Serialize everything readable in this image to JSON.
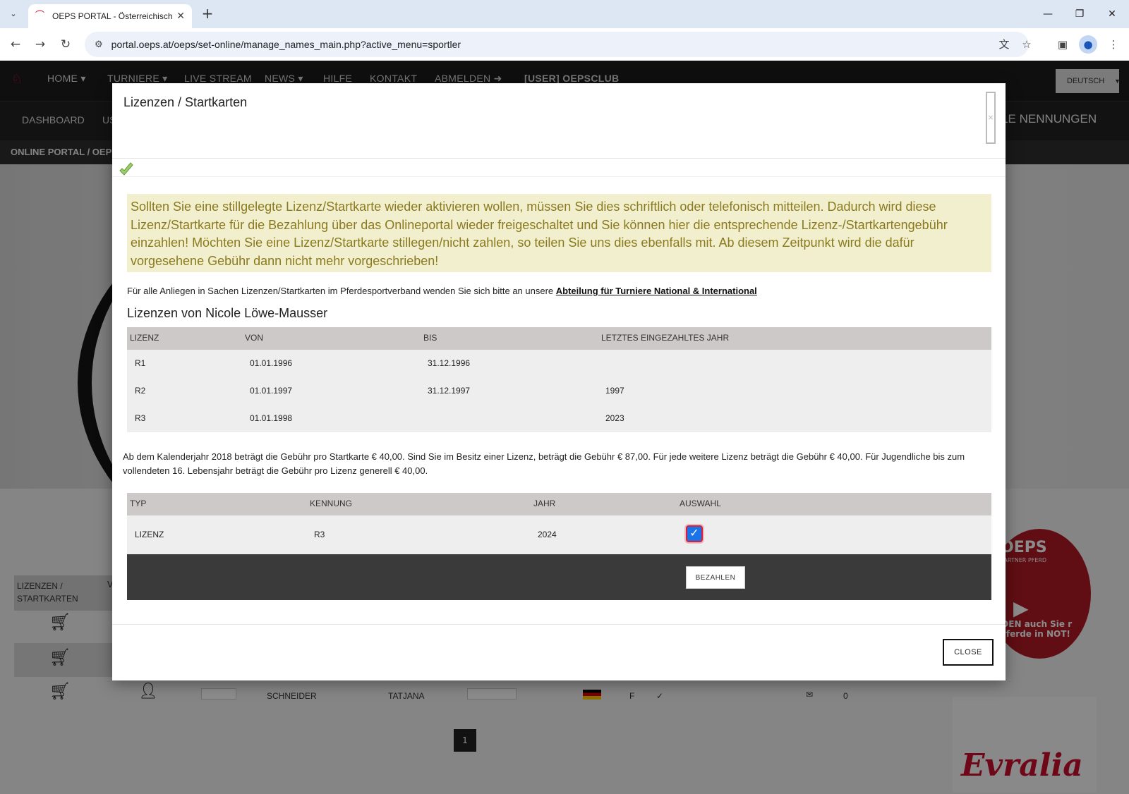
{
  "browser": {
    "tab_title": "OEPS PORTAL - Österreichische",
    "url": "portal.oeps.at/oeps/set-online/manage_names_main.php?active_menu=sportler"
  },
  "site": {
    "nav": [
      "HOME ▾",
      "TURNIERE ▾",
      "LIVE STREAM",
      "NEWS ▾",
      "HILFE",
      "KONTAKT",
      "ABMELDEN ➜",
      "[USER] OEPSCLUB"
    ],
    "language": "DEUTSCH",
    "subnav_left": "DASHBOARD",
    "subnav_left2": "US",
    "subnav_right": "UELLE NENNUNGEN",
    "breadcrumb": "ONLINE PORTAL /  OEP",
    "sidebox": "LIZENZEN / STARTKARTEN",
    "sidebox_extra": "V",
    "bottom_row": {
      "lastname": "SCHNEIDER",
      "firstname": "TATJANA",
      "gender": "F",
      "check": "✓",
      "count": "0"
    },
    "page_number": "1",
    "ad_circle_brand": "OEPS",
    "ad_circle_sub": "R PARTNER PFERD",
    "ad_circle_text": "IDEN auch Sie r Pferde in NOT!",
    "ad_logo_text": "Evralia"
  },
  "modal": {
    "title": "Lizenzen / Startkarten",
    "notice": "Sollten Sie eine stillgelegte Lizenz/Startkarte wieder aktivieren wollen, müssen Sie dies schriftlich oder telefonisch mitteilen. Dadurch wird diese Lizenz/Startkarte für die Bezahlung über das Onlineportal wieder freigeschaltet und Sie können hier die entsprechende Lizenz-/Startkartengebühr einzahlen! Möchten Sie eine Lizenz/Startkarte stillegen/nicht zahlen, so teilen Sie uns dies ebenfalls mit. Ab diesem Zeitpunkt wird die dafür vorgesehene Gebühr dann nicht mehr vorgeschrieben!",
    "contact_prefix": "Für alle Anliegen in Sachen Lizenzen/Startkarten im Pferdesportverband wenden Sie sich bitte an unsere ",
    "contact_link": "Abteilung für Turniere National & International",
    "licenses_heading": "Lizenzen von Nicole Löwe-Mausser",
    "license_table": {
      "headers": [
        "LIZENZ",
        "VON",
        "BIS",
        "LETZTES EINGEZAHLTES JAHR"
      ],
      "rows": [
        [
          "R1",
          "01.01.1996",
          "31.12.1996",
          ""
        ],
        [
          "R2",
          "01.01.1997",
          "31.12.1997",
          "1997"
        ],
        [
          "R3",
          "01.01.1998",
          "",
          "2023"
        ]
      ]
    },
    "fee_text": "Ab dem Kalenderjahr 2018 beträgt die Gebühr pro Startkarte € 40,00. Sind Sie im Besitz einer Lizenz, beträgt die Gebühr € 87,00. Für jede weitere Lizenz beträgt die Gebühr € 40,00. Für Jugendliche bis zum vollendeten 16. Lebensjahr beträgt die Gebühr pro Lizenz generell € 40,00.",
    "payment_table": {
      "headers": [
        "TYP",
        "KENNUNG",
        "JAHR",
        "AUSWAHL"
      ],
      "rows": [
        [
          "LIZENZ",
          "R3",
          "2024",
          "✓"
        ]
      ]
    },
    "pay_button": "BEZAHLEN",
    "close_button": "CLOSE"
  }
}
